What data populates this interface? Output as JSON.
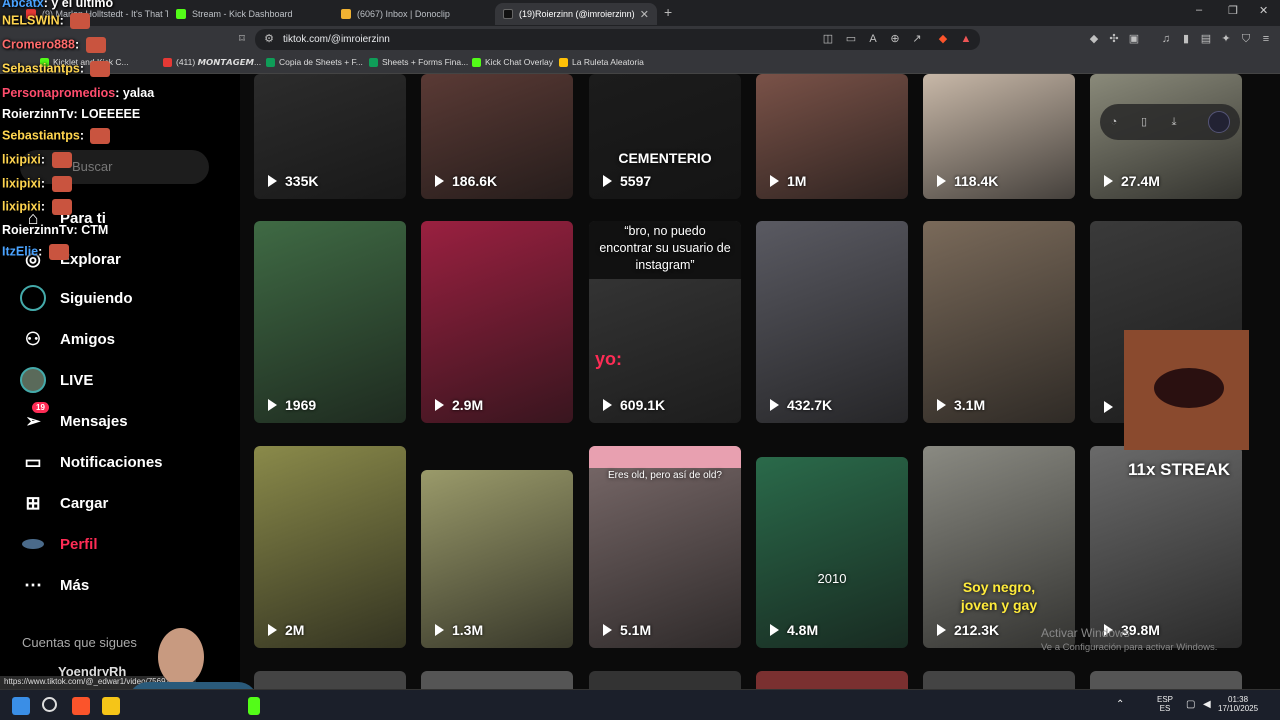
{
  "browser": {
    "tabs": [
      {
        "label": "(9) Marlon Holltstedt - It's That Time",
        "color": "#e53935"
      },
      {
        "label": "Stream - Kick Dashboard",
        "color": "#53fc18"
      },
      {
        "label": "(6067) Inbox | Donoclip",
        "color": "#f0b232"
      },
      {
        "label": "(19)Roierzinn (@imroierzinn) | Ti",
        "color": "#000000"
      }
    ],
    "url": "tiktok.com/@imroierzinn",
    "bookmarks": [
      {
        "label": "Kicklet and Kick C...",
        "color": "#53fc18"
      },
      {
        "label": "(411) 𝙈𝙊𝙉𝙏𝘼𝙂𝙀𝙈...",
        "color": "#e53935"
      },
      {
        "label": "Copia de Sheets + F...",
        "color": "#0f9d58"
      },
      {
        "label": "Sheets + Forms Fina...",
        "color": "#0f9d58"
      },
      {
        "label": "Kick Chat Overlay",
        "color": "#53fc18"
      },
      {
        "label": "La Ruleta Aleatoria",
        "color": "#ffc107"
      }
    ]
  },
  "sidebar": {
    "search_placeholder": "Buscar",
    "items": [
      {
        "label": "Para ti",
        "icon": "home-icon"
      },
      {
        "label": "Explorar",
        "icon": "compass-icon"
      },
      {
        "label": "Siguiendo",
        "icon": "following-icon"
      },
      {
        "label": "Amigos",
        "icon": "friends-icon"
      },
      {
        "label": "LIVE",
        "icon": "live-icon"
      },
      {
        "label": "Mensajes",
        "icon": "messages-icon",
        "badge": "19"
      },
      {
        "label": "Notificaciones",
        "icon": "notifications-icon"
      },
      {
        "label": "Cargar",
        "icon": "upload-icon"
      },
      {
        "label": "Perfil",
        "icon": "profile-icon"
      },
      {
        "label": "Más",
        "icon": "more-icon"
      }
    ],
    "follows_heading": "Cuentas que sigues",
    "follow_first": "YoendryRh"
  },
  "videos": [
    {
      "views": "335K",
      "bg": "#2c2c2c"
    },
    {
      "views": "186.6K",
      "bg": "#5a3a35"
    },
    {
      "views": "5597",
      "bg": "#1c1c1c",
      "caption": "CEMENTERIO"
    },
    {
      "views": "1M",
      "bg": "#7a5248"
    },
    {
      "views": "118.4K",
      "bg": "#c8b8a8"
    },
    {
      "views": "27.4M",
      "bg": "#8a8a7a"
    },
    {
      "views": "1969",
      "bg": "#3f6a44"
    },
    {
      "views": "2.9M",
      "bg": "#9a2040"
    },
    {
      "views": "609.1K",
      "bg": "#3a3a3a",
      "caption": "“bro, no puedo encontrar su usuario de instagram”",
      "label": "yo:"
    },
    {
      "views": "432.7K",
      "bg": "#5a5a62"
    },
    {
      "views": "3.1M",
      "bg": "#7a6a5a"
    },
    {
      "views": "",
      "bg": "#3a3a3a"
    },
    {
      "views": "2M",
      "bg": "#8a8a4a"
    },
    {
      "views": "1.3M",
      "bg": "#9a9a6a"
    },
    {
      "views": "5.1M",
      "bg": "#7a6a6a",
      "caption": "Eres old, pero así de old?"
    },
    {
      "views": "4.8M",
      "bg": "#2a6a4a",
      "caption": "2010"
    },
    {
      "views": "212.3K",
      "bg": "#8a8a82",
      "caption": "Soy negro, joven y gay"
    },
    {
      "views": "39.8M",
      "bg": "#6a6a6a"
    }
  ],
  "chat": [
    {
      "user": "Abcatx",
      "msg": "y el último",
      "color": "#4aa3ff"
    },
    {
      "user": "NELSWIN",
      "msg": "",
      "color": "#ffd54f",
      "emote": true
    },
    {
      "user": "Cromero888",
      "msg": "",
      "color": "#ff6b6b",
      "emote": true
    },
    {
      "user": "Sebastiantps",
      "msg": "",
      "color": "#ffd54f",
      "emote": true
    },
    {
      "user": "Personapromedios",
      "msg": "yalaa",
      "color": "#ff4d6d"
    },
    {
      "user": "RoierzinnTv",
      "msg": "LOEEEEE",
      "color": "#ffffff"
    },
    {
      "user": "Sebastiantps",
      "msg": "",
      "color": "#ffd54f",
      "emote": true
    },
    {
      "user": "lixipixi",
      "msg": "",
      "color": "#ffd54f",
      "emote": true
    },
    {
      "user": "lixipixi",
      "msg": "",
      "color": "#ffd54f",
      "emote": true
    },
    {
      "user": "lixipixi",
      "msg": "",
      "color": "#ffd54f",
      "emote": true
    },
    {
      "user": "RoierzinnTv",
      "msg": "CTM",
      "color": "#ffffff"
    },
    {
      "user": "ItzElie",
      "msg": "",
      "color": "#4aa3ff",
      "emote": true
    }
  ],
  "overlay": {
    "streak": "11x STREAK",
    "activate_title": "Activar Windows",
    "activate_sub": "Ve a Configuración para activar Windows."
  },
  "statusbar": "https://www.tiktok.com/@_edwar1/video/7569119495",
  "taskbar": {
    "lang": "ESP",
    "lang2": "ES",
    "time": "01:38",
    "date": "17/10/2025"
  }
}
